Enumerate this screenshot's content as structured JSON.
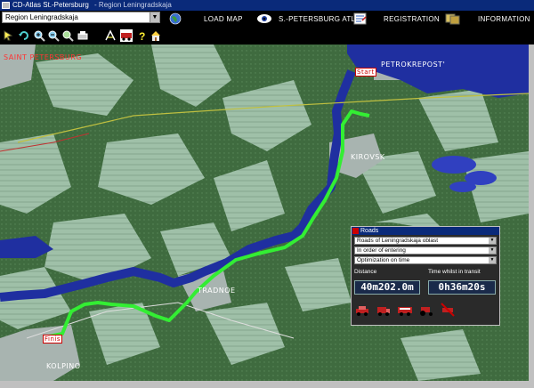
{
  "window": {
    "title": "CD-Atlas St.-Petersburg",
    "subtitle": "- Region Leningradskaja"
  },
  "menubar": {
    "region_select": "Region Leningradskaja",
    "load_map": "LOAD MAP",
    "atlas": "S.-PETERSBURG ATLAS",
    "registration": "REGISTRATION",
    "information": "INFORMATION"
  },
  "map": {
    "labels": {
      "saint_petersburg": "SAINT PETERSBURG",
      "petrokrepost": "PETROKREPOST'",
      "kirovsk": "KIROVSK",
      "tradnoe": "TRADNOE",
      "kolpino": "KOLPINO",
      "start": "Start",
      "finish": "Finis"
    },
    "colors": {
      "forest": "#3f6b3f",
      "field": "#8fb39a",
      "water": "#1f2fa0",
      "route": "#33ee33",
      "urban": "#a8b4b0"
    }
  },
  "route_panel": {
    "title": "Roads",
    "road_type": "Roads of Leningradskaja oblast",
    "order": "In order of entering",
    "optimization": "Optimization on time",
    "distance_label": "Distance",
    "time_label": "Time whilst in transit",
    "distance_value": "40m202.0m",
    "time_value": "0h36m20s"
  }
}
